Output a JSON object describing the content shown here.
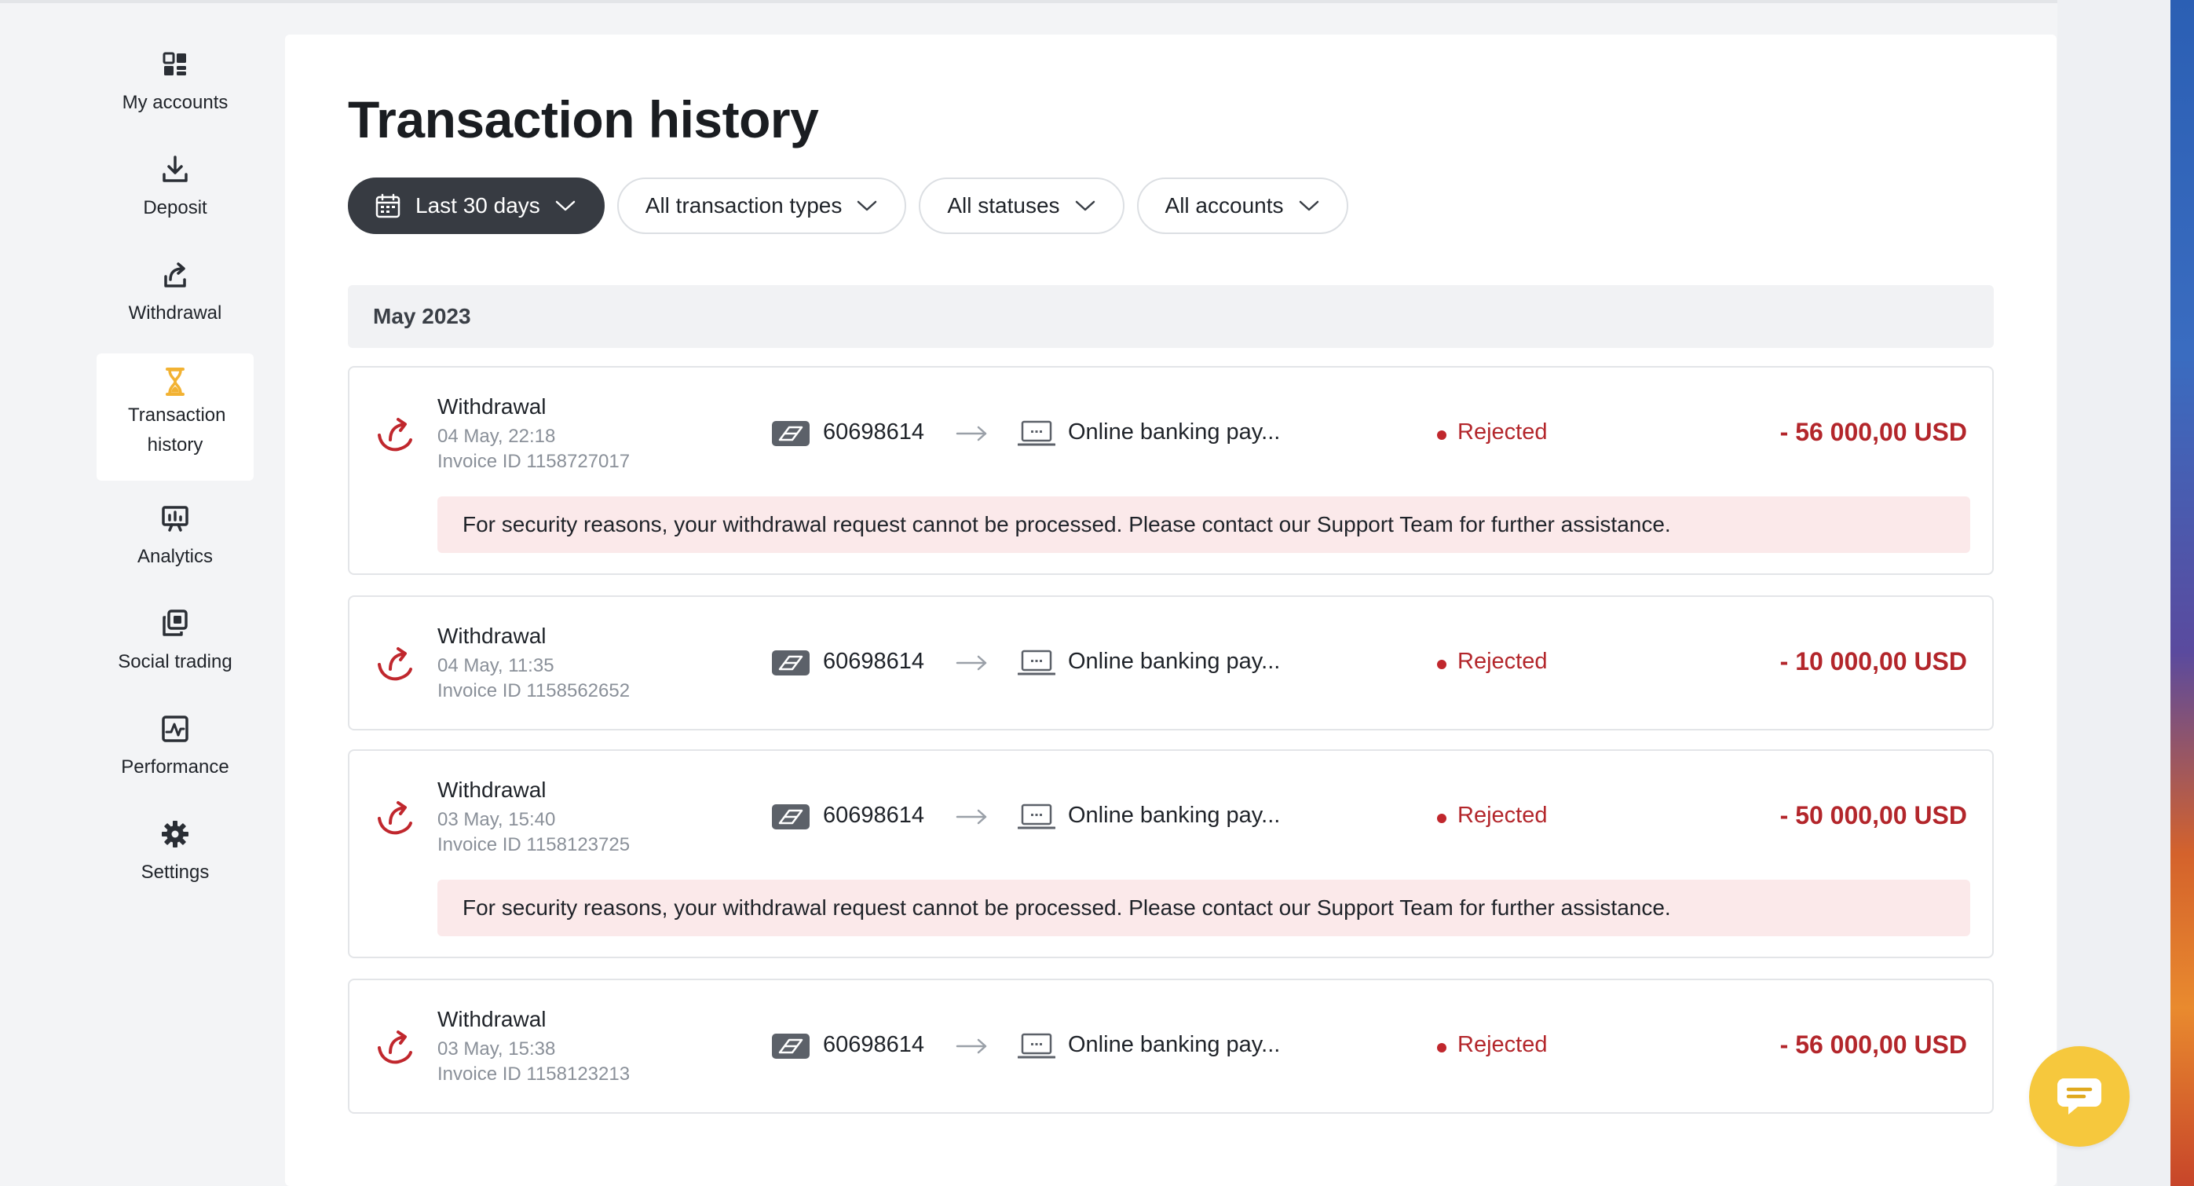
{
  "sidebar": {
    "items": [
      {
        "label": "My accounts",
        "icon": "grid-icon"
      },
      {
        "label": "Deposit",
        "icon": "download-icon"
      },
      {
        "label": "Withdrawal",
        "icon": "upload-share-icon"
      },
      {
        "label": "Transaction history",
        "icon": "hourglass-icon",
        "active": true
      },
      {
        "label": "Analytics",
        "icon": "chart-board-icon"
      },
      {
        "label": "Social trading",
        "icon": "copy-squares-icon"
      },
      {
        "label": "Performance",
        "icon": "pulse-chart-icon"
      },
      {
        "label": "Settings",
        "icon": "gear-icon"
      }
    ]
  },
  "main": {
    "title": "Transaction history",
    "filters": [
      {
        "label": "Last 30 days",
        "icon": "calendar-icon"
      },
      {
        "label": "All transaction types"
      },
      {
        "label": "All statuses"
      },
      {
        "label": "All accounts"
      }
    ],
    "month": "May 2023",
    "transactions": [
      {
        "type": "Withdrawal",
        "date": "04 May, 22:18",
        "invoice": "Invoice ID 1158727017",
        "account": "60698614",
        "method": "Online banking pay...",
        "status": "Rejected",
        "amount": "- 56 000,00 USD",
        "notice": "For security reasons, your withdrawal request cannot be processed. Please contact our Support Team for further assistance."
      },
      {
        "type": "Withdrawal",
        "date": "04 May, 11:35",
        "invoice": "Invoice ID 1158562652",
        "account": "60698614",
        "method": "Online banking pay...",
        "status": "Rejected",
        "amount": "- 10 000,00 USD"
      },
      {
        "type": "Withdrawal",
        "date": "03 May, 15:40",
        "invoice": "Invoice ID 1158123725",
        "account": "60698614",
        "method": "Online banking pay...",
        "status": "Rejected",
        "amount": "- 50 000,00 USD",
        "notice": "For security reasons, your withdrawal request cannot be processed. Please contact our Support Team for further assistance."
      },
      {
        "type": "Withdrawal",
        "date": "03 May, 15:38",
        "invoice": "Invoice ID 1158123213",
        "account": "60698614",
        "method": "Online banking pay...",
        "status": "Rejected",
        "amount": "- 56 000,00 USD"
      }
    ]
  },
  "colors": {
    "accent_dark": "#373b42",
    "rejected_red": "#b3262b",
    "notice_bg": "#fbe9ea",
    "active_icon": "#f2b233",
    "chat_button": "#f6c83d"
  },
  "chat": {
    "icon": "chat-bubble-icon"
  }
}
